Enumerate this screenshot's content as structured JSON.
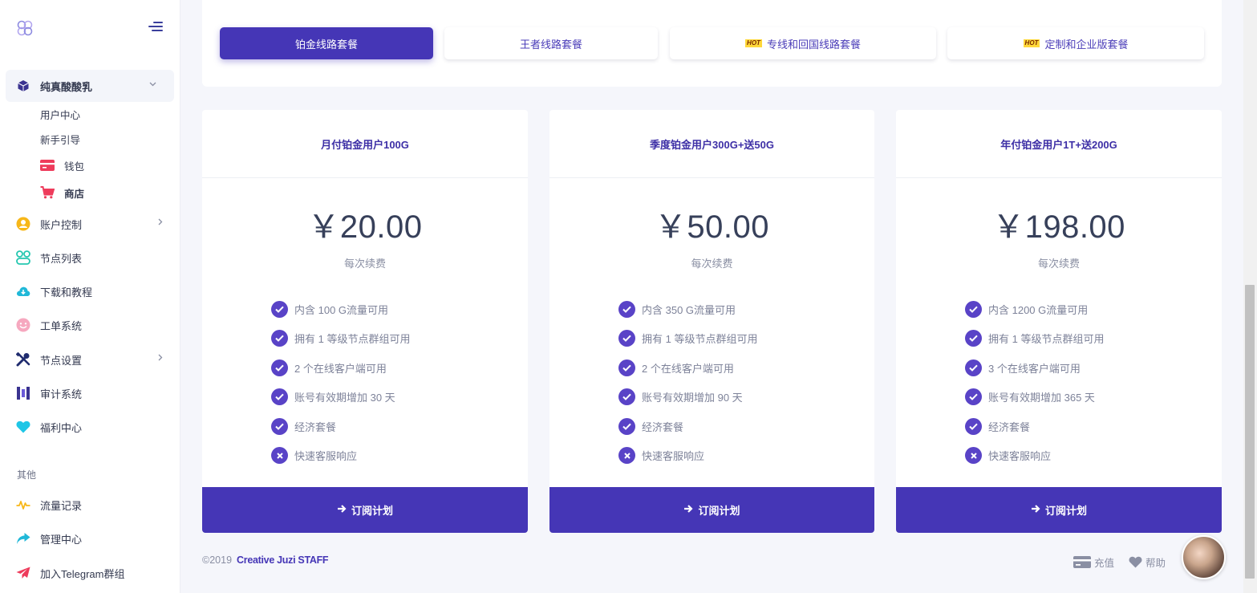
{
  "sidebar": {
    "active_item": "纯真酸酸乳",
    "sub_items": [
      {
        "label": "用户中心"
      },
      {
        "label": "新手引导"
      },
      {
        "label": "钱包"
      },
      {
        "label": "商店"
      }
    ],
    "items": [
      {
        "label": "账户控制"
      },
      {
        "label": "节点列表"
      },
      {
        "label": "下载和教程"
      },
      {
        "label": "工单系统"
      },
      {
        "label": "节点设置"
      },
      {
        "label": "审计系统"
      },
      {
        "label": "福利中心"
      }
    ],
    "section_label": "其他",
    "other_items": [
      {
        "label": "流量记录"
      },
      {
        "label": "管理中心"
      },
      {
        "label": "加入Telegram群组"
      }
    ]
  },
  "tabs": [
    {
      "label": "铂金线路套餐",
      "active": true,
      "hot": false
    },
    {
      "label": "王者线路套餐",
      "active": false,
      "hot": false
    },
    {
      "label": "专线和回国线路套餐",
      "active": false,
      "hot": true
    },
    {
      "label": "定制和企业版套餐",
      "active": false,
      "hot": true
    }
  ],
  "hot_badge": "HOT",
  "plans": [
    {
      "title": "月付铂金用户100G",
      "price": "￥20.00",
      "period": "每次续费",
      "features": [
        {
          "text": "内含 100 G流量可用",
          "included": true
        },
        {
          "text": "拥有 1 等级节点群组可用",
          "included": true
        },
        {
          "text": "2 个在线客户端可用",
          "included": true
        },
        {
          "text": "账号有效期增加 30 天",
          "included": true
        },
        {
          "text": "经济套餐",
          "included": true
        },
        {
          "text": "快速客服响应",
          "included": false
        }
      ],
      "button": "订阅计划"
    },
    {
      "title": "季度铂金用户300G+送50G",
      "price": "￥50.00",
      "period": "每次续费",
      "features": [
        {
          "text": "内含 350 G流量可用",
          "included": true
        },
        {
          "text": "拥有 1 等级节点群组可用",
          "included": true
        },
        {
          "text": "2 个在线客户端可用",
          "included": true
        },
        {
          "text": "账号有效期增加 90 天",
          "included": true
        },
        {
          "text": "经济套餐",
          "included": true
        },
        {
          "text": "快速客服响应",
          "included": false
        }
      ],
      "button": "订阅计划"
    },
    {
      "title": "年付铂金用户1T+送200G",
      "price": "￥198.00",
      "period": "每次续费",
      "features": [
        {
          "text": "内含 1200 G流量可用",
          "included": true
        },
        {
          "text": "拥有 1 等级节点群组可用",
          "included": true
        },
        {
          "text": "3 个在线客户端可用",
          "included": true
        },
        {
          "text": "账号有效期增加 365 天",
          "included": true
        },
        {
          "text": "经济套餐",
          "included": true
        },
        {
          "text": "快速客服响应",
          "included": false
        }
      ],
      "button": "订阅计划"
    }
  ],
  "footer": {
    "copyright": "©2019",
    "brand": "Creative Juzi  STAFF",
    "recharge": "充值",
    "help": "帮助"
  },
  "colors": {
    "primary": "#4536b6",
    "check": "#5943c7",
    "text": "#37405a",
    "muted": "#8a8fa3"
  }
}
